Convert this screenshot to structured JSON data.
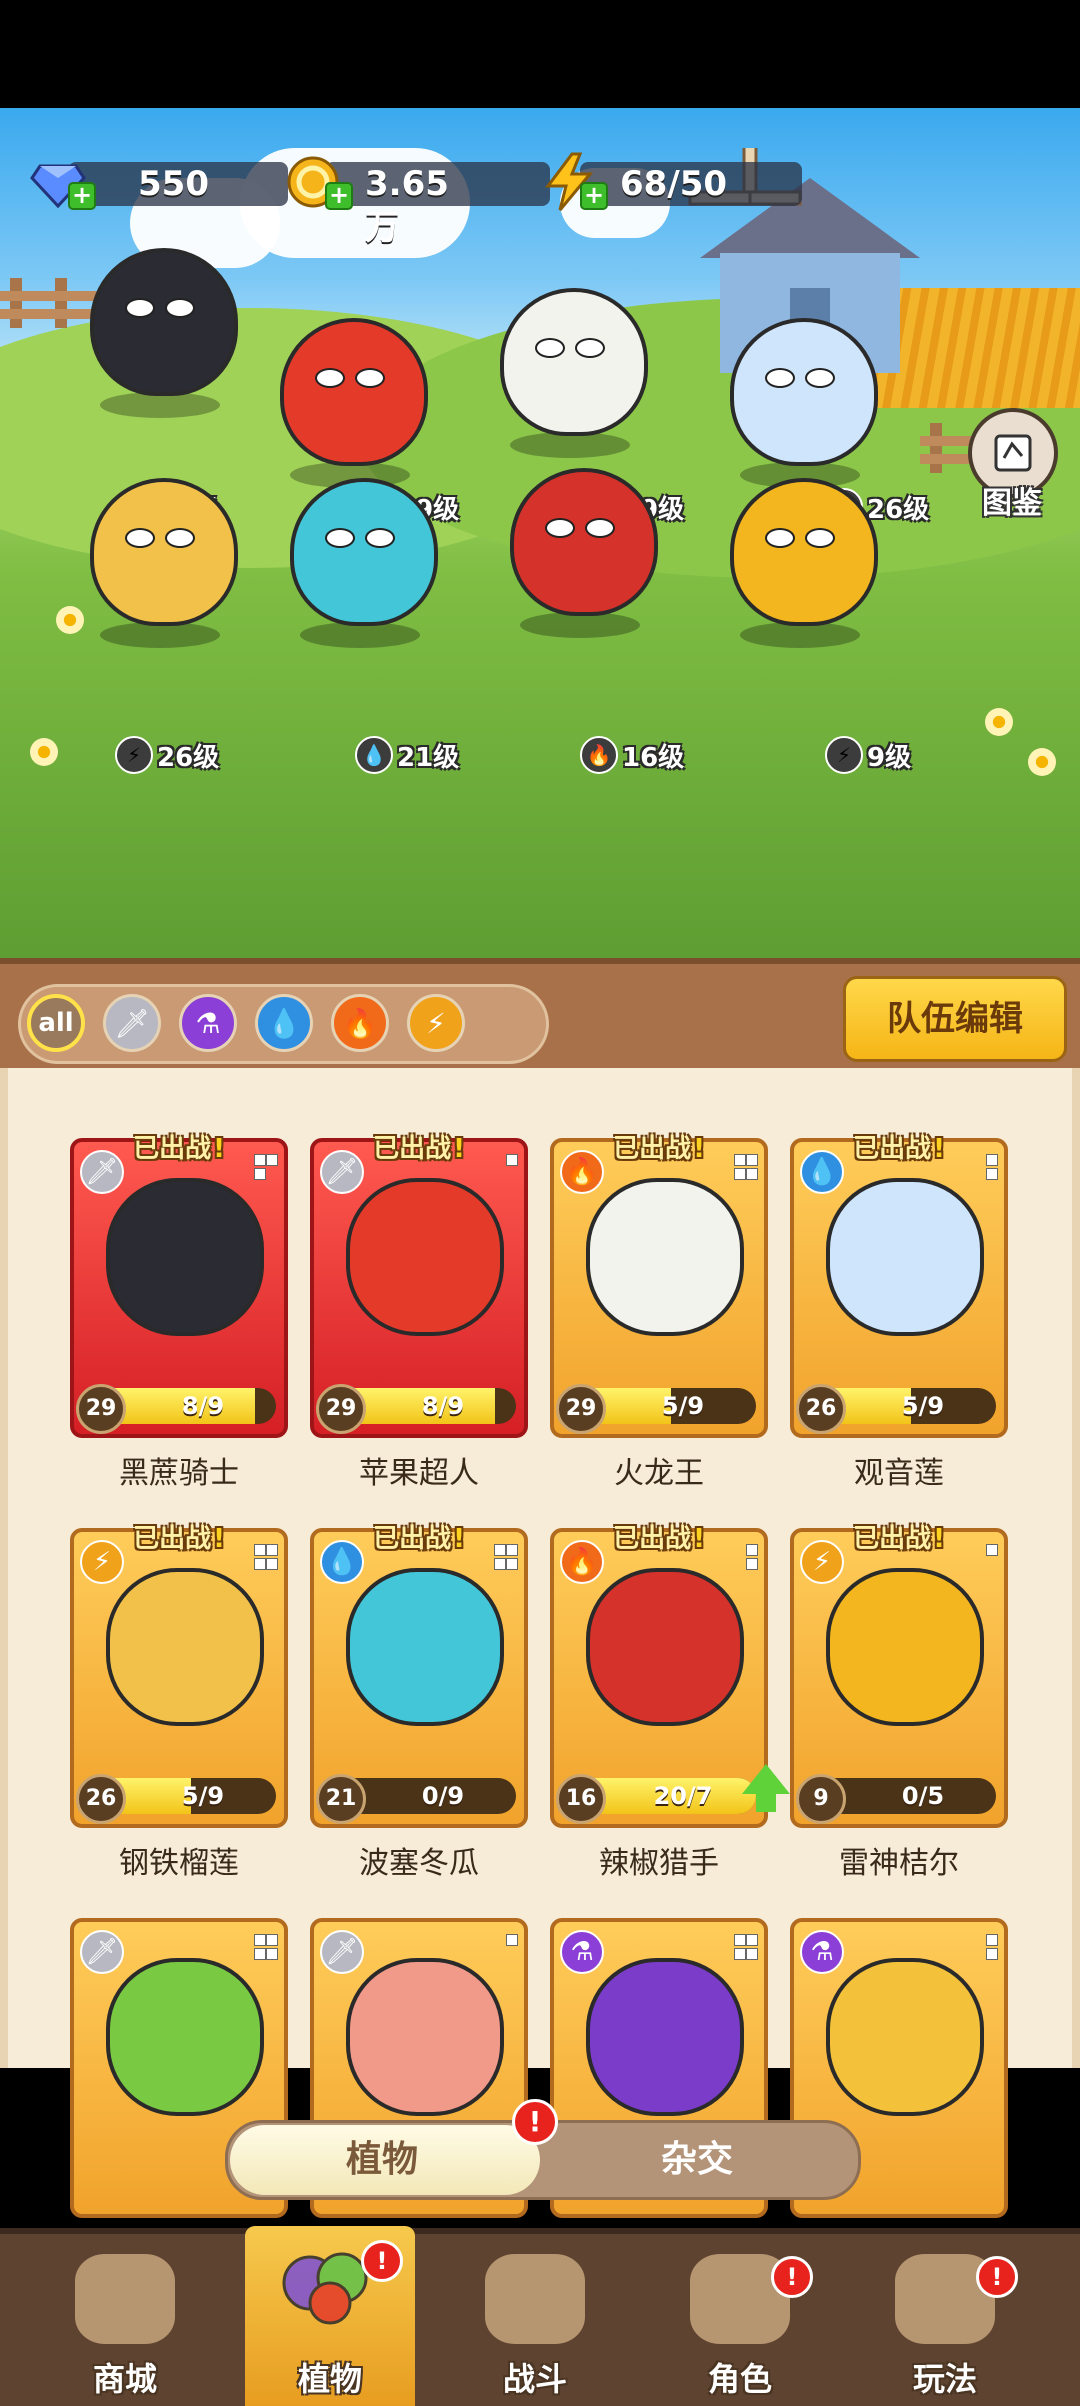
{
  "resources": {
    "gems": {
      "value": "550",
      "icon": "diamond-icon"
    },
    "coins": {
      "value": "3.65万",
      "icon": "coin-icon"
    },
    "energy": {
      "value": "68/50",
      "icon": "lightning-icon"
    }
  },
  "codex": {
    "label": "图鉴",
    "icon": "book-icon"
  },
  "lineup": [
    {
      "level": "29级",
      "element": "sword",
      "color": "#2b2b33"
    },
    {
      "level": "29级",
      "element": "sword",
      "color": "#e43a2a"
    },
    {
      "level": "29级",
      "element": "fire",
      "color": "#f3f3ee"
    },
    {
      "level": "26级",
      "element": "water",
      "color": "#cfe5fb"
    },
    {
      "level": "26级",
      "element": "lightning",
      "color": "#f2c14a"
    },
    {
      "level": "21级",
      "element": "water",
      "color": "#43c7d8"
    },
    {
      "level": "16级",
      "element": "fire",
      "color": "#d4322a"
    },
    {
      "level": "9级",
      "element": "lightning",
      "color": "#f4b61f"
    }
  ],
  "filters": [
    {
      "label": "all",
      "icon": "all-icon",
      "color": "#9a7a5c",
      "selected": true
    },
    {
      "label": "",
      "icon": "sword-icon",
      "color": "#b8b8c2",
      "selected": false
    },
    {
      "label": "",
      "icon": "potion-icon",
      "color": "#8b3fd6",
      "selected": false
    },
    {
      "label": "",
      "icon": "water-icon",
      "color": "#2f8fe0",
      "selected": false
    },
    {
      "label": "",
      "icon": "fire-icon",
      "color": "#f06a1a",
      "selected": false
    },
    {
      "label": "",
      "icon": "lightning-icon",
      "color": "#f0a21a",
      "selected": false
    }
  ],
  "team_edit_label": "队伍编辑",
  "deployed_label": "已出战",
  "cards": [
    {
      "name": "黑蔗骑士",
      "level": "29",
      "shards": "8/9",
      "progress": 0.89,
      "element": "sword",
      "style": "red",
      "color": "#2b2b33",
      "deployed": true,
      "upgrade": false
    },
    {
      "name": "苹果超人",
      "level": "29",
      "shards": "8/9",
      "progress": 0.89,
      "element": "sword",
      "style": "red",
      "color": "#e43a2a",
      "deployed": true,
      "upgrade": false
    },
    {
      "name": "火龙王",
      "level": "29",
      "shards": "5/9",
      "progress": 0.56,
      "element": "fire",
      "style": "gold",
      "color": "#f3f3ee",
      "deployed": true,
      "upgrade": false
    },
    {
      "name": "观音莲",
      "level": "26",
      "shards": "5/9",
      "progress": 0.56,
      "element": "water",
      "style": "gold",
      "color": "#cfe5fb",
      "deployed": true,
      "upgrade": false
    },
    {
      "name": "钢铁榴莲",
      "level": "26",
      "shards": "5/9",
      "progress": 0.56,
      "element": "lightning",
      "style": "gold",
      "color": "#f2c14a",
      "deployed": true,
      "upgrade": false
    },
    {
      "name": "波塞冬瓜",
      "level": "21",
      "shards": "0/9",
      "progress": 0,
      "element": "water",
      "style": "gold",
      "color": "#43c7d8",
      "deployed": true,
      "upgrade": false
    },
    {
      "name": "辣椒猎手",
      "level": "16",
      "shards": "20/7",
      "progress": 1,
      "element": "fire",
      "style": "gold",
      "color": "#d4322a",
      "deployed": true,
      "upgrade": true
    },
    {
      "name": "雷神桔尔",
      "level": "9",
      "shards": "0/5",
      "progress": 0,
      "element": "lightning",
      "style": "gold",
      "color": "#f4b61f",
      "deployed": true,
      "upgrade": false
    },
    {
      "name": "",
      "level": "",
      "shards": "",
      "progress": 0,
      "element": "sword",
      "style": "gold",
      "color": "#7ac943",
      "deployed": false,
      "upgrade": false
    },
    {
      "name": "",
      "level": "",
      "shards": "",
      "progress": 0,
      "element": "sword",
      "style": "gold",
      "color": "#f29a8a",
      "deployed": false,
      "upgrade": false
    },
    {
      "name": "",
      "level": "",
      "shards": "",
      "progress": 0,
      "element": "potion",
      "style": "gold",
      "color": "#7b3cc9",
      "deployed": false,
      "upgrade": false
    },
    {
      "name": "",
      "level": "",
      "shards": "",
      "progress": 0,
      "element": "potion",
      "style": "gold",
      "color": "#f3c13a",
      "deployed": false,
      "upgrade": false
    }
  ],
  "toggle": {
    "plants": "植物",
    "hybrid": "杂交",
    "alert": "!"
  },
  "nav": [
    {
      "label": "商城",
      "icon": "shop-icon",
      "active": false,
      "alert": false
    },
    {
      "label": "植物",
      "icon": "plants-icon",
      "active": true,
      "alert": true
    },
    {
      "label": "战斗",
      "icon": "battle-icon",
      "active": false,
      "alert": false
    },
    {
      "label": "角色",
      "icon": "character-icon",
      "active": false,
      "alert": true
    },
    {
      "label": "玩法",
      "icon": "gameplay-icon",
      "active": false,
      "alert": true
    }
  ],
  "nav_alert": "!"
}
